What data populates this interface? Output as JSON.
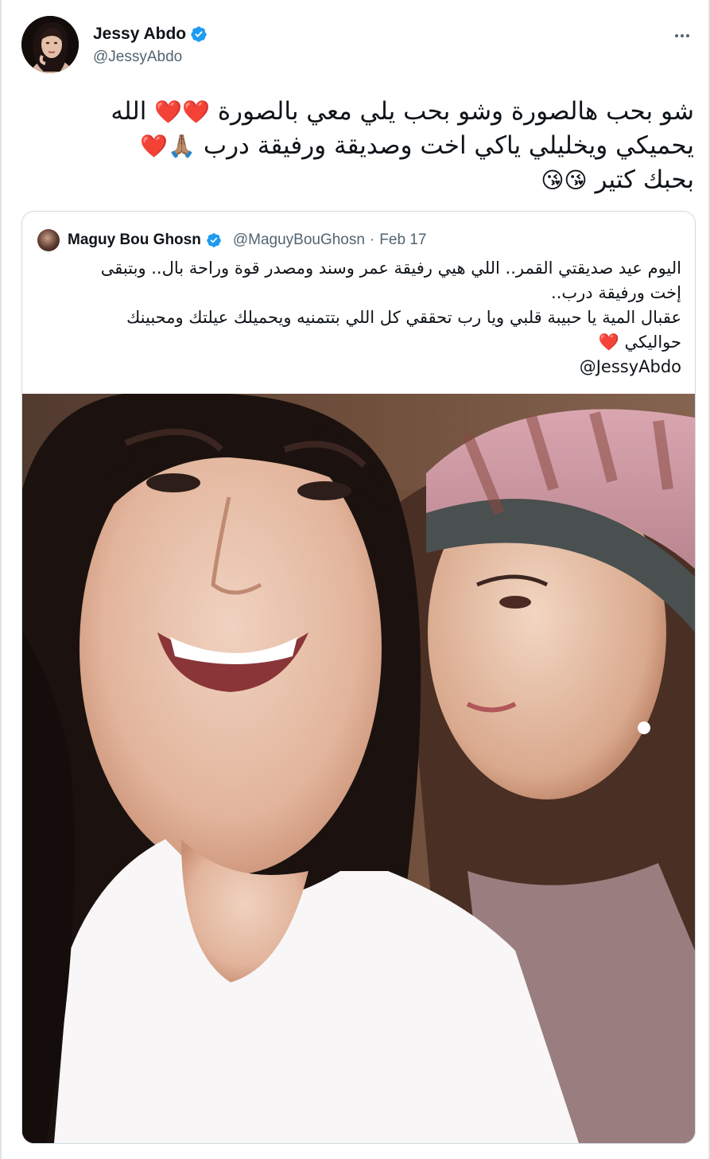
{
  "tweet": {
    "author": {
      "display_name": "Jessy Abdo",
      "handle": "@JessyAbdo",
      "verified": true,
      "verified_icon": "verified-badge-icon"
    },
    "more_icon": "more-horizontal-icon",
    "lines": [
      {
        "text": "شو بحب هالصورة وشو بحب يلي معي بالصورة",
        "emoji": "❤️❤️",
        "tail": "الله"
      },
      {
        "text": "يحميكي ويخليلي ياكي اخت وصديقة ورفيقة درب",
        "emoji": "🙏🏽❤️"
      },
      {
        "text": "بحبك كتير",
        "emoji": "😘😘"
      }
    ]
  },
  "quoted_tweet": {
    "author": {
      "display_name": "Maguy Bou Ghosn",
      "handle": "@MaguyBouGhosn",
      "verified": true
    },
    "separator": "·",
    "date": "Feb 17",
    "lines": [
      "اليوم عيد صديقتي القمر.. اللي هيي رفيقة عمر وسند ومصدر قوة وراحة بال.. وبتبقى",
      "إخت ورفيقة درب..",
      "عقبال المية يا حبيبة قلبي ويا رب تحققي كل اللي بتتمنيه ويحميلك عيلتك ومحبينك",
      "حواليكي"
    ],
    "heart_emoji": "❤️",
    "mention": "@JessyAbdo"
  },
  "colors": {
    "text_primary": "#0f1419",
    "text_secondary": "#536471",
    "verified_blue": "#1d9bf0",
    "border": "#cfd9de",
    "heart_red": "#dd2e44"
  }
}
